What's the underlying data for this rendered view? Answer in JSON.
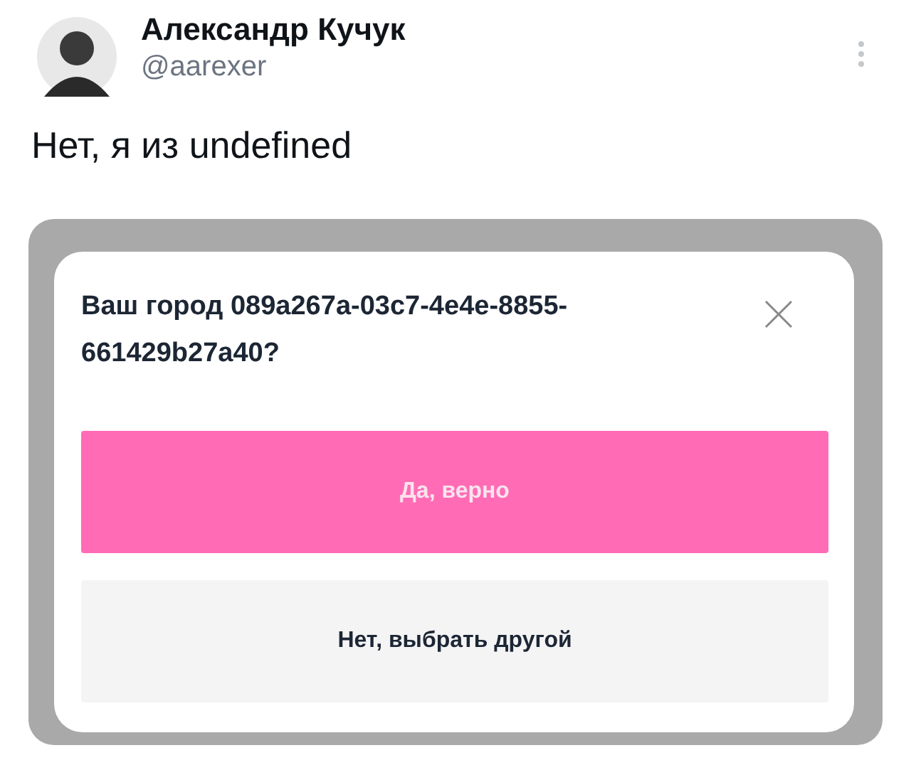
{
  "author": {
    "name": "Александр Кучук",
    "handle": "@aarexer"
  },
  "tweet_text": "Нет, я из undefined",
  "dialog": {
    "title": "Ваш город 089a267a-03c7-4e4e-8855-661429b27a40?",
    "buttons": [
      {
        "label": "Да, верно",
        "kind": "primary"
      },
      {
        "label": "Нет, выбрать другой",
        "kind": "secondary"
      }
    ]
  }
}
